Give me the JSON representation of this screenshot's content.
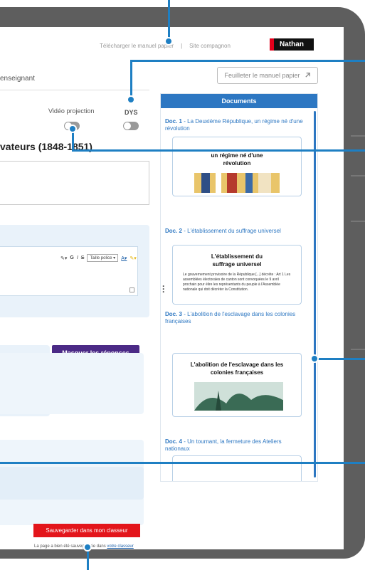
{
  "header": {
    "link_download": "Télécharger le manuel papier",
    "link_separator": "|",
    "link_companion": "Site compagnon",
    "brand_logo": "Nathan"
  },
  "tabs": {
    "active_label": "enseignant"
  },
  "toolbar": {
    "feuilleter_label": "Feuilleter le manuel papier",
    "video_label": "Vidéo projection",
    "dys_label": "DYS"
  },
  "page": {
    "heading": "vateurs (1848-1851)"
  },
  "editor": {
    "bold": "G",
    "italic": "I",
    "strike": "S",
    "font_select": "Taille police",
    "color": "A"
  },
  "actions": {
    "masquer_label": "Masquer les réponses",
    "save_label": "Sauvegarder dans mon classeur",
    "save_note_prefix": "La page a bien été sauvegardée dans",
    "save_note_link": "votre classeur"
  },
  "documents": {
    "header": "Documents",
    "items": [
      {
        "num": "Doc. 1",
        "title": "La Deuxième République, un régime né d'une révolution",
        "card_title": "un régime né d'une révolution",
        "card_text": ""
      },
      {
        "num": "Doc. 2",
        "title": "L'établissement du suffrage universel",
        "card_title": "L'établissement du suffrage universel",
        "card_text": "Le gouvernement provisoire de la République [...] décrète : Art 1 Les assemblées électorales de canton sont convoquées le 9 avril prochain pour élire les représentants du peuple à l'Assemblée nationale qui doit décréter la Constitution."
      },
      {
        "num": "Doc. 3",
        "title": "L'abolition de l'esclavage dans les colonies françaises",
        "card_title": "L'abolition de l'esclavage dans les colonies françaises",
        "card_text": ""
      },
      {
        "num": "Doc. 4",
        "title": "Un tournant, la fermeture des Ateliers nationaux",
        "card_title": "",
        "card_text": ""
      }
    ]
  },
  "colors": {
    "frame": "#5e5e5e",
    "accent_blue": "#2d77c2",
    "callout": "#1e7fc3",
    "masquer": "#4b2a86",
    "save": "#e3151b"
  }
}
